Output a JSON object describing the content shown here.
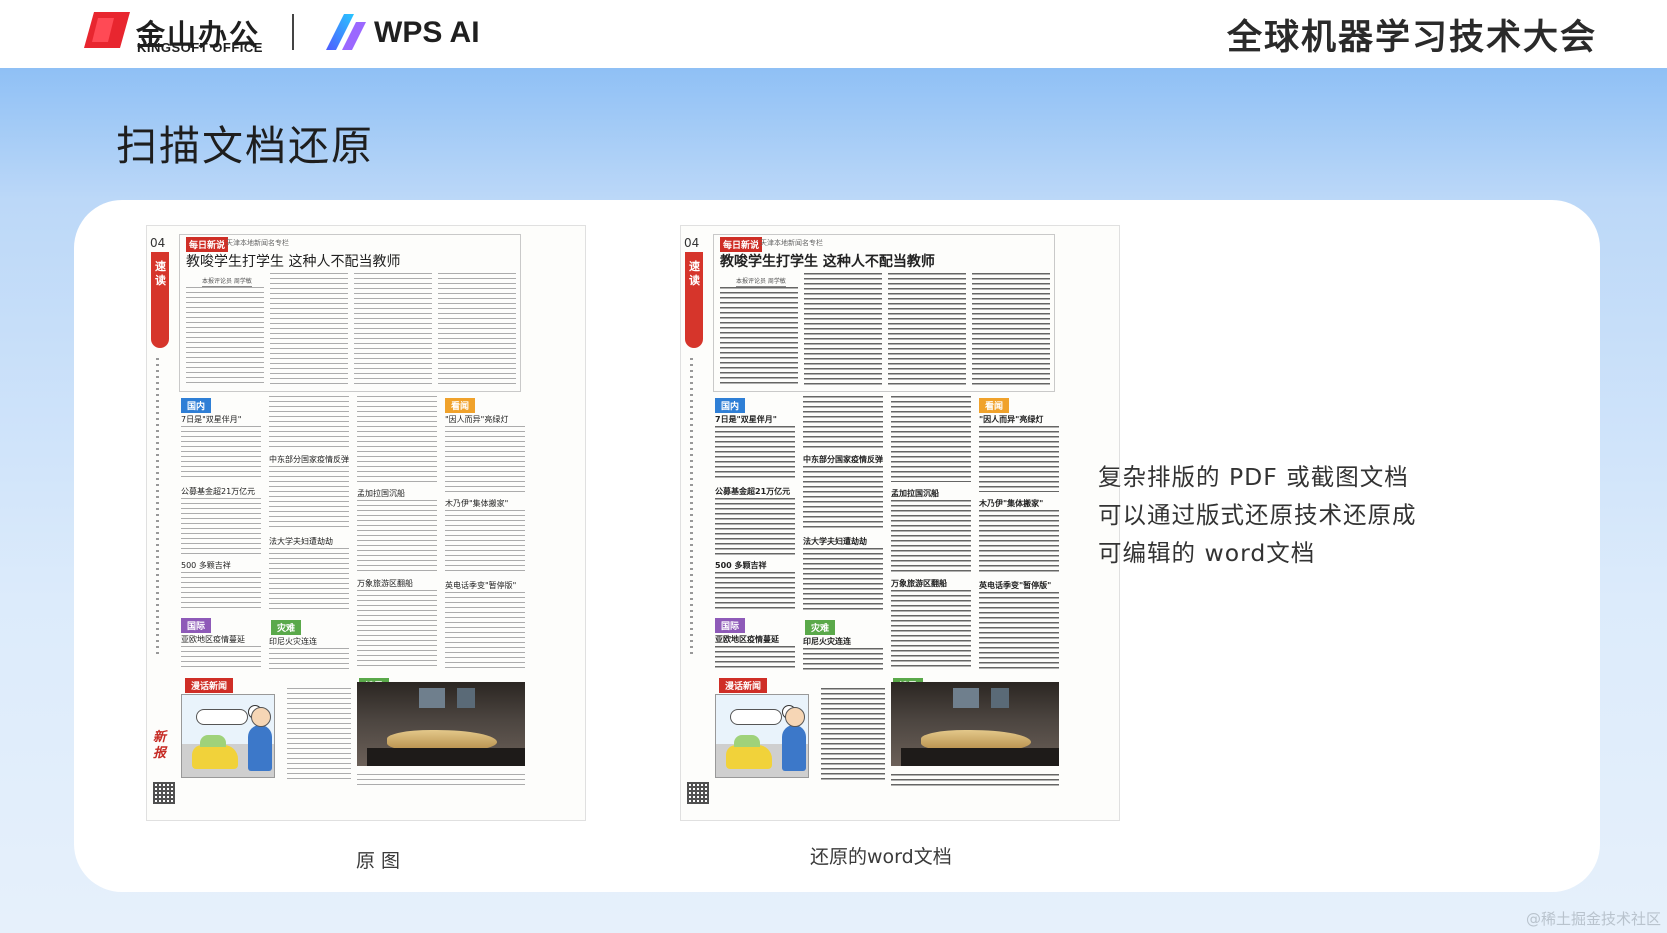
{
  "header": {
    "kingsoft_cn": "金山办公",
    "kingsoft_en": "KINGSOFT OFFICE",
    "wps_ai": "WPS AI",
    "conference_title": "全球机器学习技术大会"
  },
  "slide": {
    "title": "扫描文档还原",
    "description_lines": [
      "复杂排版的 PDF 或截图文档",
      "可以通过版式还原技术还原成",
      "可编辑的 word文档"
    ]
  },
  "newspaper": {
    "issue": "04",
    "side_label": "速读",
    "brand": "新报",
    "column_tag": "每日新说",
    "column_sub": "天津本地新闻名专栏",
    "headline": "教唆学生打学生 这种人不配当教师",
    "byline": "本报评论员 周学敏",
    "sections": {
      "domestic": "国内",
      "watch": "看闻",
      "international": "国际",
      "disaster": "灾难",
      "comic": "漫话新闻",
      "mirror": "镜界"
    },
    "mini_headlines": {
      "h1": "7日是\"双星伴月\"",
      "h2": "公募基金超21万亿元",
      "h3": "500 多颗吉祥",
      "h4": "亚欧地区疫情蔓延",
      "h5": "中东部分国家疫情反弹",
      "h6": "孟加拉国沉船",
      "h7": "法大学夫妇遭劫劫",
      "h8": "印尼火灾连连",
      "h9": "万象旅游区翻船",
      "h10": "\"因人而异\"亮绿灯",
      "h11": "木乃伊\"集体搬家\"",
      "h12": "英电话季变\"暂停版\""
    }
  },
  "captions": {
    "original": "原 图",
    "restored": "还原的word文档"
  },
  "watermark": "@稀土掘金技术社区",
  "colors": {
    "kingsoft_red": "#e8262f",
    "wps_gradient_start": "#4f5bff",
    "wps_gradient_end": "#28c6ff",
    "newspaper_red": "#cf2e26"
  }
}
